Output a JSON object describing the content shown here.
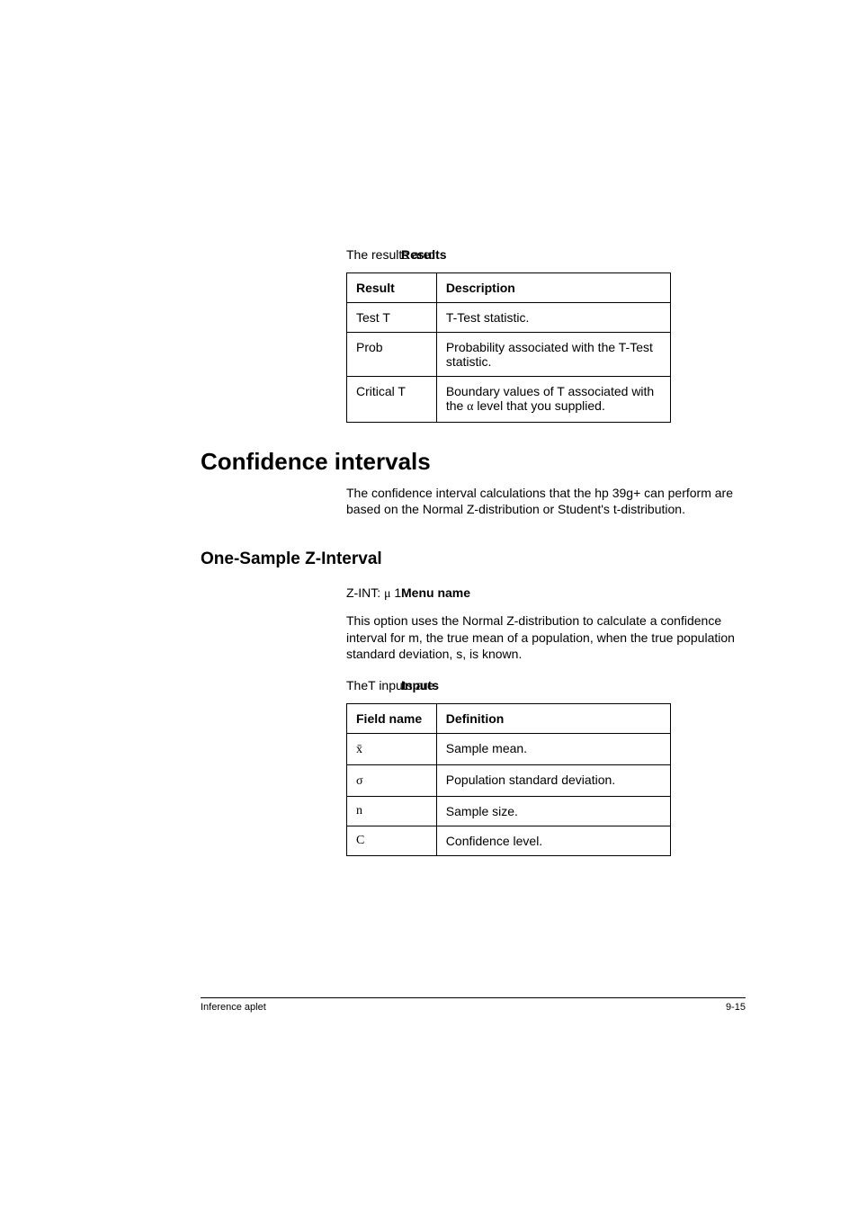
{
  "sections": {
    "results": {
      "label": "Results",
      "intro": "The results are:",
      "table": {
        "headers": [
          "Result",
          "Description"
        ],
        "rows": [
          {
            "c1": "Test T",
            "c2": "T-Test statistic."
          },
          {
            "c1": "Prob",
            "c2": "Probability associated with the T-Test statistic."
          },
          {
            "c1": "Critical T",
            "c2_prefix": "Boundary values of T associated with the ",
            "c2_symbol": "α",
            "c2_suffix": " level that you supplied."
          }
        ]
      }
    },
    "confidence": {
      "heading": "Confidence intervals",
      "para": "The confidence interval calculations that the hp 39g+ can perform are based on the Normal Z-distribution or Student's t-distribution."
    },
    "onesample": {
      "heading": "One-Sample Z-Interval"
    },
    "menuname": {
      "label": "Menu name",
      "value_prefix": "Z-INT: ",
      "value_symbol": "μ",
      "value_suffix": " 1",
      "para": "This option uses the Normal Z-distribution to calculate a confidence interval for m, the true mean of a population, when the true population standard deviation, s, is known."
    },
    "inputs": {
      "label": "Inputs",
      "intro": "TheT inputs are:",
      "table": {
        "headers": [
          "Field name",
          "Definition"
        ],
        "rows": [
          {
            "c1": "x̄",
            "c2": "Sample mean."
          },
          {
            "c1": "σ",
            "c2": "Population standard deviation."
          },
          {
            "c1": "n",
            "c2": "Sample size."
          },
          {
            "c1": "C",
            "c2": "Confidence level."
          }
        ]
      }
    }
  },
  "footer": {
    "left": "Inference aplet",
    "right": "9-15"
  }
}
